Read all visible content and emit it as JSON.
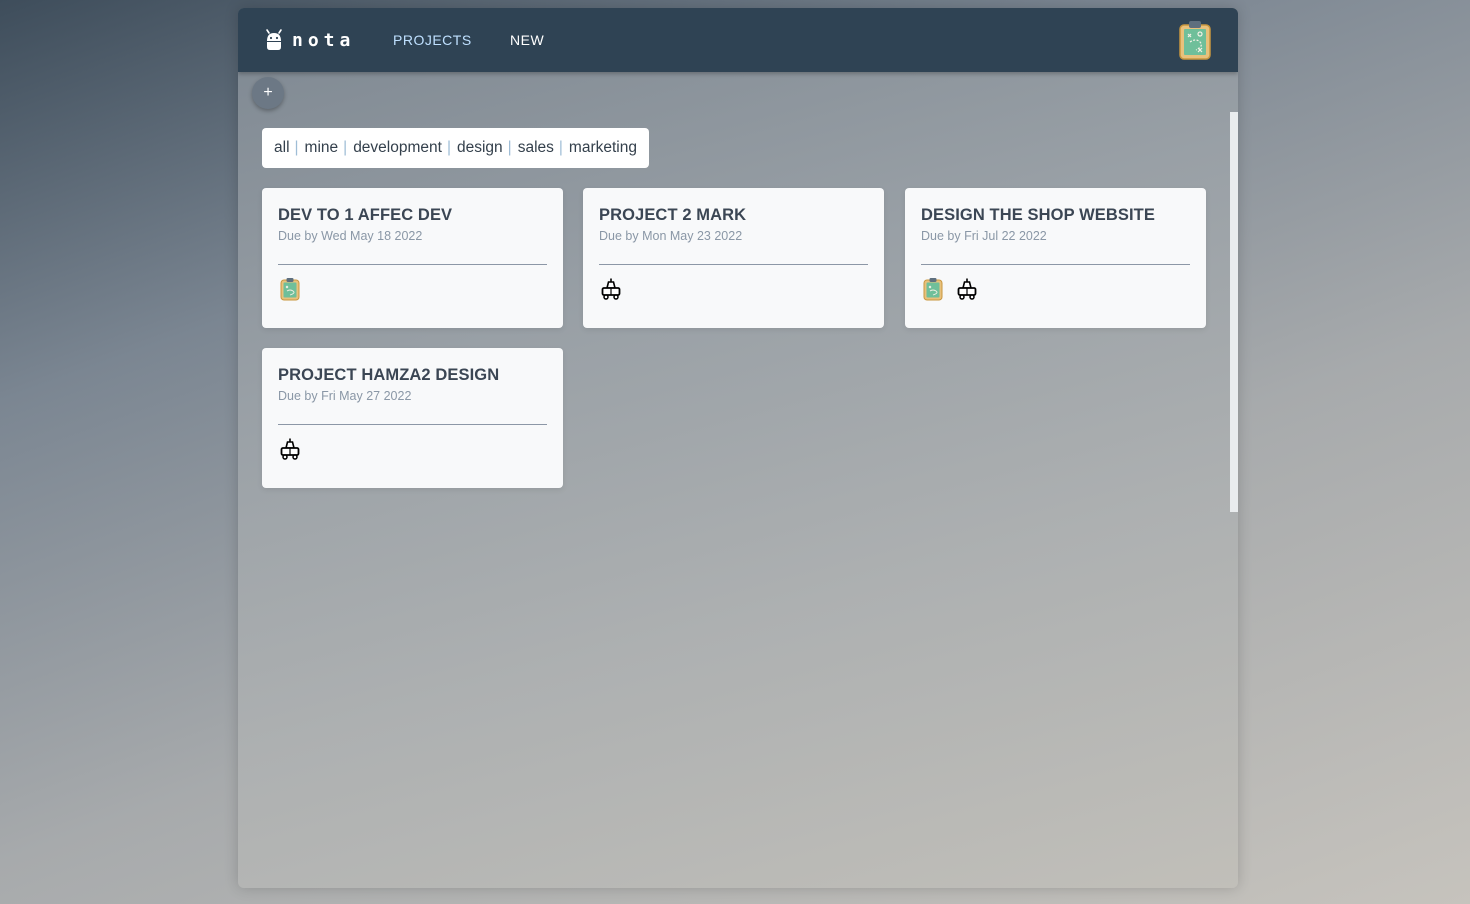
{
  "app": {
    "brand": "nota",
    "nav": {
      "projects_label": "PROJECTS",
      "new_label": "NEW"
    },
    "user_avatar_icon": "clipboard-avatar-icon"
  },
  "toolbar": {
    "add_label": "+"
  },
  "filters": [
    {
      "label": "all"
    },
    {
      "label": "mine"
    },
    {
      "label": "development"
    },
    {
      "label": "design"
    },
    {
      "label": "sales"
    },
    {
      "label": "marketing"
    }
  ],
  "projects": [
    {
      "title": "DEV TO 1 AFFEC DEV",
      "due": "Due by Wed May 18 2022",
      "members": [
        "clipboard-avatar-icon"
      ]
    },
    {
      "title": "PROJECT 2 MARK",
      "due": "Due by Mon May 23 2022",
      "members": [
        "robot-avatar-icon"
      ]
    },
    {
      "title": "DESIGN THE SHOP WEBSITE",
      "due": "Due by Fri Jul 22 2022",
      "members": [
        "clipboard-avatar-icon",
        "robot-avatar-icon"
      ]
    },
    {
      "title": "PROJECT HAMZA2 DESIGN",
      "due": "Due by Fri May 27 2022",
      "members": [
        "robot-avatar-icon"
      ]
    }
  ],
  "colors": {
    "navbar": "#2f4354",
    "active_nav": "#bfe0ff",
    "card": "#f8f9fa",
    "title_text": "#3b4654",
    "due_text": "#8a97a6",
    "filter_separator": "#9fbdd6"
  }
}
